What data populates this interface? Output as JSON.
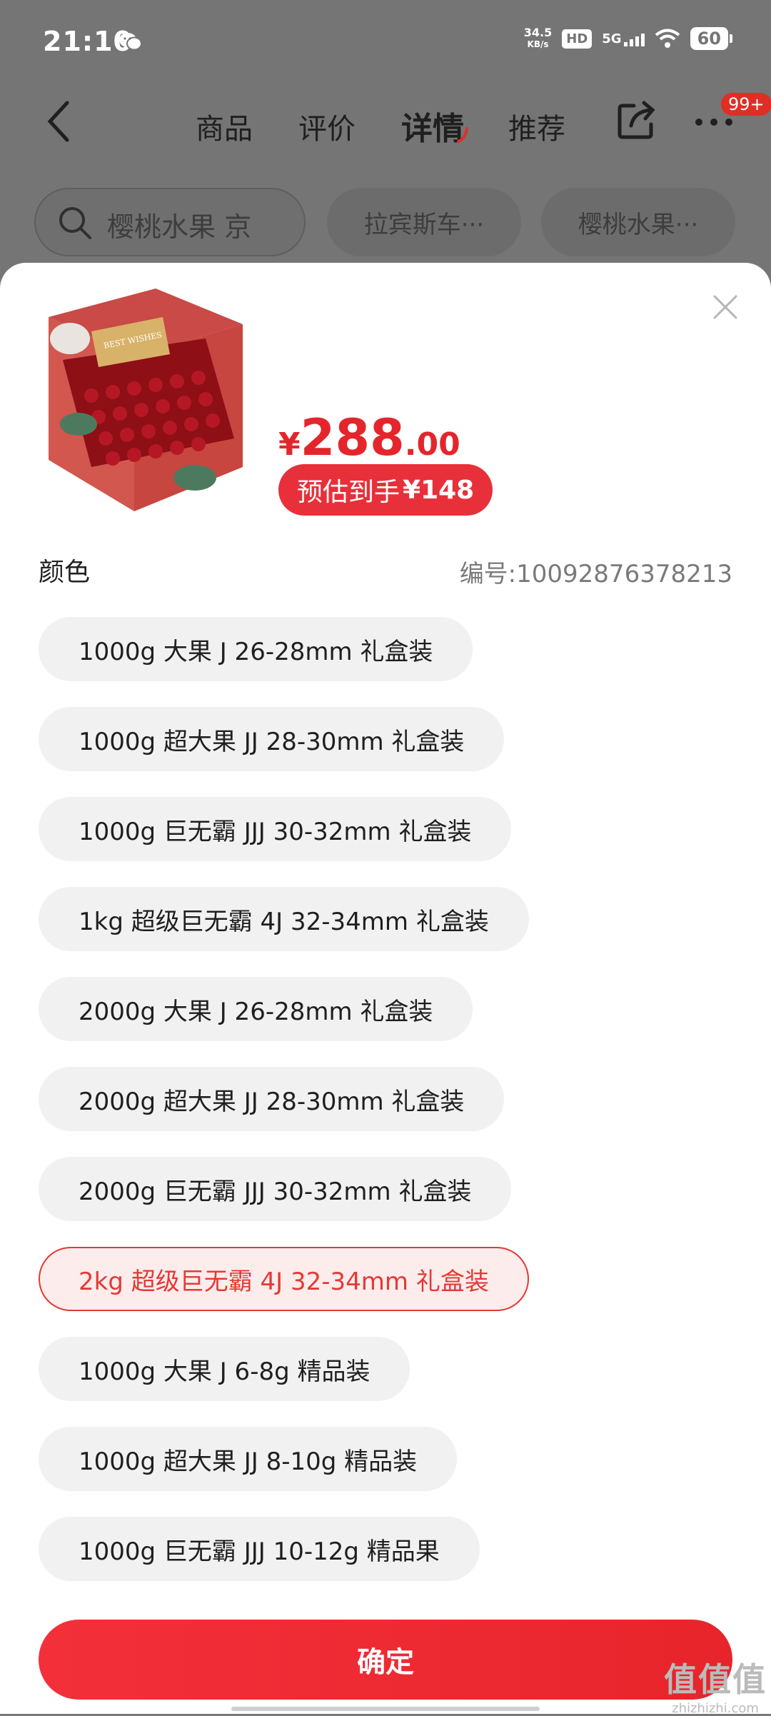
{
  "status_bar": {
    "time": "21:10",
    "net_speed": "34.5",
    "net_unit": "KB/s",
    "hd": "HD",
    "signal": "5G",
    "battery": "60"
  },
  "nav": {
    "tabs": [
      {
        "label": "商品",
        "active": false
      },
      {
        "label": "评价",
        "active": false
      },
      {
        "label": "详情",
        "active": true
      },
      {
        "label": "推荐",
        "active": false
      }
    ],
    "badge": "99+"
  },
  "search": {
    "placeholder": "樱桃水果 京",
    "chips": [
      "拉宾斯车···",
      "樱桃水果···"
    ]
  },
  "product": {
    "price_symbol": "¥",
    "price_int": "288",
    "price_dec": ".00",
    "estimate_label": "预估到手",
    "estimate_value": "¥148",
    "color_label": "颜色",
    "sku_number": "编号:10092876378213"
  },
  "options": [
    {
      "label": "1000g 大果 J 26-28mm 礼盒装",
      "selected": false
    },
    {
      "label": "1000g 超大果 JJ  28-30mm 礼盒装",
      "selected": false
    },
    {
      "label": "1000g 巨无霸 JJJ 30-32mm 礼盒装",
      "selected": false
    },
    {
      "label": "1kg 超级巨无霸 4J 32-34mm 礼盒装",
      "selected": false
    },
    {
      "label": "2000g 大果 J 26-28mm 礼盒装",
      "selected": false
    },
    {
      "label": "2000g 超大果 JJ  28-30mm 礼盒装",
      "selected": false
    },
    {
      "label": "2000g 巨无霸 JJJ 30-32mm 礼盒装",
      "selected": false
    },
    {
      "label": "2kg 超级巨无霸 4J 32-34mm 礼盒装",
      "selected": true
    },
    {
      "label": "1000g 大果 J 6-8g 精品装",
      "selected": false
    },
    {
      "label": "1000g 超大果 JJ  8-10g 精品装",
      "selected": false
    },
    {
      "label": "1000g 巨无霸 JJJ 10-12g 精品果",
      "selected": false
    }
  ],
  "confirm_label": "确定",
  "watermark": {
    "big": "值值值",
    "small": "zhizhizhi.com"
  },
  "gift_card_text": "BEST WISHES",
  "colors": {
    "accent": "#e4262c",
    "selected_bg": "#fdecec",
    "option_bg": "#f1f1f1"
  }
}
